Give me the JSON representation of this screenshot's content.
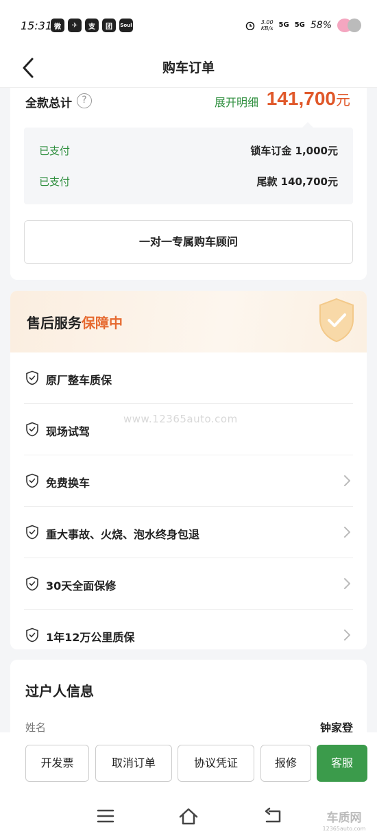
{
  "status_bar": {
    "time": "15:31",
    "apps": [
      "微",
      "✈",
      "支",
      "团",
      "Soul"
    ],
    "net_speed_value": "3.00",
    "net_speed_unit": "KB/s",
    "signal1": "5G",
    "signal2": "5G",
    "battery": "58%"
  },
  "header": {
    "title": "购车订单"
  },
  "payment": {
    "total_label": "全款总计",
    "help_icon_text": "?",
    "expand_label": "展开明细",
    "total_amount": "141,700",
    "total_unit": "元",
    "rows": [
      {
        "status": "已支付",
        "desc": "锁车订金 1,000元"
      },
      {
        "status": "已支付",
        "desc": "尾款 140,700元"
      }
    ],
    "advisor_button": "一对一专属购车顾问"
  },
  "service": {
    "title_part1": "售后服务",
    "title_part2": "保障中",
    "items": [
      {
        "label": "原厂整车质保",
        "arrow": false
      },
      {
        "label": "现场试驾",
        "arrow": false
      },
      {
        "label": "免费换车",
        "arrow": true
      },
      {
        "label": "重大事故、火烧、泡水终身包退",
        "arrow": true
      },
      {
        "label": "30天全面保修",
        "arrow": true
      },
      {
        "label": "1年12万公里质保",
        "arrow": true
      }
    ]
  },
  "owner": {
    "title": "过户人信息",
    "name_label": "姓名",
    "name_value": "钟家登"
  },
  "actions": {
    "invoice": "开发票",
    "cancel_order": "取消订单",
    "agreement": "协议凭证",
    "repair": "报修",
    "customer_service": "客服"
  },
  "watermark": {
    "center": "www.12365auto.com",
    "logo_text": "车质网",
    "logo_url": "12365auto.com"
  },
  "colors": {
    "accent_green": "#3b9b4b",
    "status_green": "#2f8f3f",
    "amount_orange": "#e0582a",
    "highlight_orange": "#e66a30"
  }
}
